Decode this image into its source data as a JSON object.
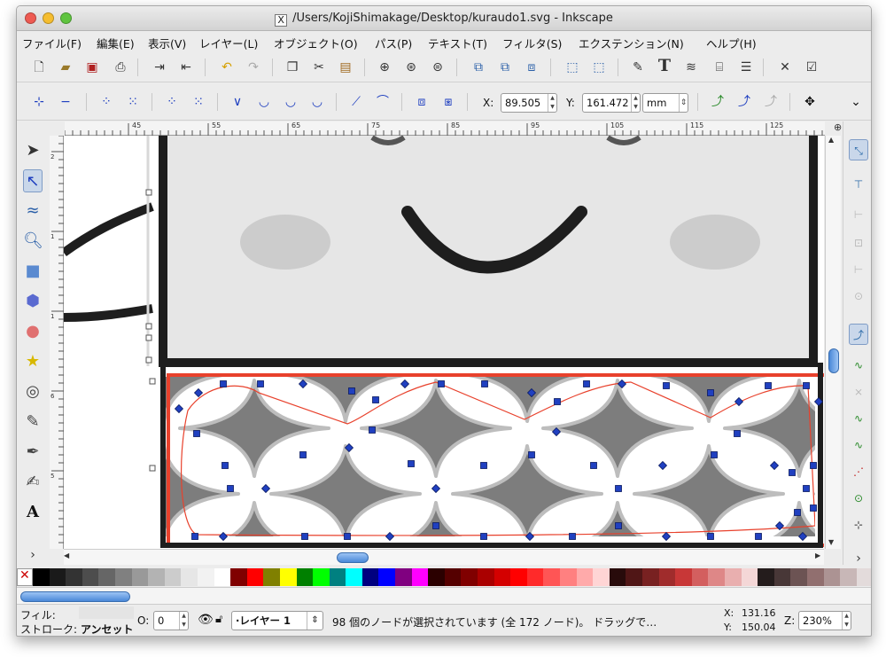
{
  "window": {
    "title": "/Users/KojiShimakage/Desktop/kuraudo1.svg - Inkscape",
    "title_icon": "X",
    "traffic_lights": [
      "#ee5a52",
      "#f5bd2f",
      "#5fc43f"
    ]
  },
  "menu": [
    "ファイル(F)",
    "編集(E)",
    "表示(V)",
    "レイヤー(L)",
    "オブジェクト(O)",
    "パス(P)",
    "テキスト(T)",
    "フィルタ(S)",
    "エクステンション(N)",
    "ヘルプ(H)"
  ],
  "toolbar1_icons": [
    "new-doc-icon",
    "open-icon",
    "save-icon",
    "print-icon",
    "import-icon",
    "export-icon",
    "undo-icon",
    "redo-icon",
    "copy-icon",
    "cut-icon",
    "paste-icon",
    "zoom-selection-icon",
    "zoom-drawing-icon",
    "zoom-page-icon",
    "duplicate-icon",
    "clone-icon",
    "unlink-clone-icon",
    "group-icon",
    "ungroup-icon",
    "fill-stroke-icon",
    "text-icon",
    "layers-icon",
    "xml-editor-icon",
    "align-icon",
    "preferences-icon",
    "document-properties-icon"
  ],
  "node_toolbar": {
    "x_label": "X:",
    "x_value": "89.505",
    "y_label": "Y:",
    "y_value": "161.472",
    "unit": "mm",
    "more_icon": "chevron-down-icon"
  },
  "ruler": {
    "labels": [
      "45",
      "55",
      "65",
      "75",
      "85",
      "95",
      "105",
      "115",
      "125"
    ],
    "left_labels": [
      "2",
      "1",
      "1",
      "6",
      "5"
    ]
  },
  "tools": [
    "selector-icon",
    "node-tool-icon",
    "tweak-icon",
    "zoom-icon",
    "rect-icon",
    "3dbox-icon",
    "ellipse-icon",
    "star-icon",
    "spiral-icon",
    "pencil-icon",
    "pen-icon",
    "calligraphy-icon",
    "text-tool-icon"
  ],
  "palette": [
    "#000000",
    "#1a1a1a",
    "#333333",
    "#4d4d4d",
    "#666666",
    "#808080",
    "#999999",
    "#b3b3b3",
    "#cccccc",
    "#e6e6e6",
    "#f2f2f2",
    "#ffffff",
    "#800000",
    "#ff0000",
    "#808000",
    "#ffff00",
    "#008000",
    "#00ff00",
    "#008080",
    "#00ffff",
    "#000080",
    "#0000ff",
    "#800080",
    "#ff00ff",
    "#2b0000",
    "#550000",
    "#800000",
    "#aa0000",
    "#d40000",
    "#ff0000",
    "#ff2a2a",
    "#ff5555",
    "#ff8080",
    "#ffaaaa",
    "#ffd5d5",
    "#280b0b",
    "#501616",
    "#782121",
    "#a02c2c",
    "#c83737",
    "#d35f5f",
    "#de8787",
    "#e9afaf",
    "#f4d7d7",
    "#241c1c",
    "#483737",
    "#6c5353",
    "#916f6f",
    "#ac9393",
    "#c8b7b7",
    "#e3dbdb"
  ],
  "status": {
    "fill_label": "フィル:",
    "stroke_label": "ストローク:",
    "stroke_value": "アンセット",
    "opacity_label": "O:",
    "opacity_value": "0",
    "layer": "·レイヤー 1",
    "message": "98 個のノードが選択されています (全 172 ノード)。 ドラッグで…",
    "cursor_x_label": "X:",
    "cursor_x": "131.16",
    "cursor_y_label": "Y:",
    "cursor_y": "150.04",
    "zoom_label": "Z:",
    "zoom": "230%"
  },
  "colors": {
    "selection_red": "#e8412c",
    "node_blue": "#2040c0",
    "face_gray": "#e6e6e6",
    "pattern_gray": "#7d7d7d",
    "cheek_gray": "#cccccc",
    "outline": "#1e1e1e"
  }
}
